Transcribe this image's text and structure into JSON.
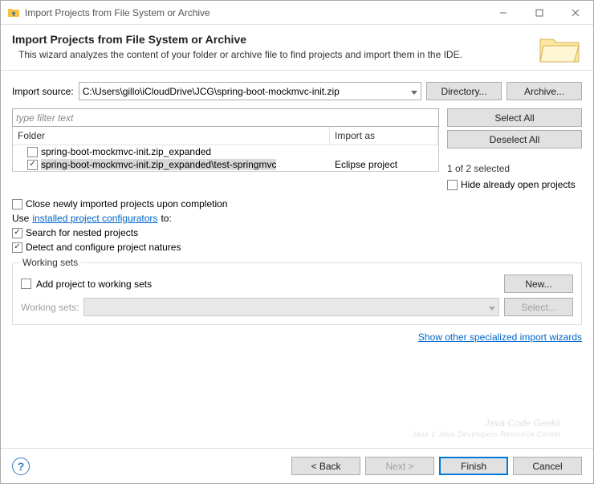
{
  "window": {
    "title": "Import Projects from File System or Archive"
  },
  "banner": {
    "heading": "Import Projects from File System or Archive",
    "description": "This wizard analyzes the content of your folder or archive file to find projects and import them in the IDE."
  },
  "importSource": {
    "label": "Import source:",
    "value": "C:\\Users\\gillo\\iCloudDrive\\JCG\\spring-boot-mockmvc-init.zip",
    "directoryBtn": "Directory...",
    "archiveBtn": "Archive..."
  },
  "filter": {
    "placeholder": "type filter text"
  },
  "table": {
    "columns": {
      "folder": "Folder",
      "importAs": "Import as"
    },
    "rows": [
      {
        "checked": false,
        "folder": "spring-boot-mockmvc-init.zip_expanded",
        "importAs": ""
      },
      {
        "checked": true,
        "folder": "spring-boot-mockmvc-init.zip_expanded\\test-springmvc",
        "importAs": "Eclipse project"
      }
    ]
  },
  "sideButtons": {
    "selectAll": "Select All",
    "deselectAll": "Deselect All",
    "status": "1 of 2 selected",
    "hideOpen": "Hide already open projects"
  },
  "options": {
    "closeOnImport": "Close newly imported projects upon completion",
    "useConfiguratorsPrefix": "Use ",
    "useConfiguratorsLink": "installed project configurators",
    "useConfiguratorsSuffix": " to:",
    "searchNested": "Search for nested projects",
    "detectNatures": "Detect and configure project natures"
  },
  "workingSets": {
    "legend": "Working sets",
    "addToSets": "Add project to working sets",
    "newBtn": "New...",
    "label": "Working sets:",
    "selectBtn": "Select..."
  },
  "links": {
    "showOther": "Show other specialized import wizards"
  },
  "watermark": {
    "main": "Java Code Geeks",
    "sub": "Java 2 Java Developers Resource Center"
  },
  "footer": {
    "back": "< Back",
    "next": "Next >",
    "finish": "Finish",
    "cancel": "Cancel"
  }
}
